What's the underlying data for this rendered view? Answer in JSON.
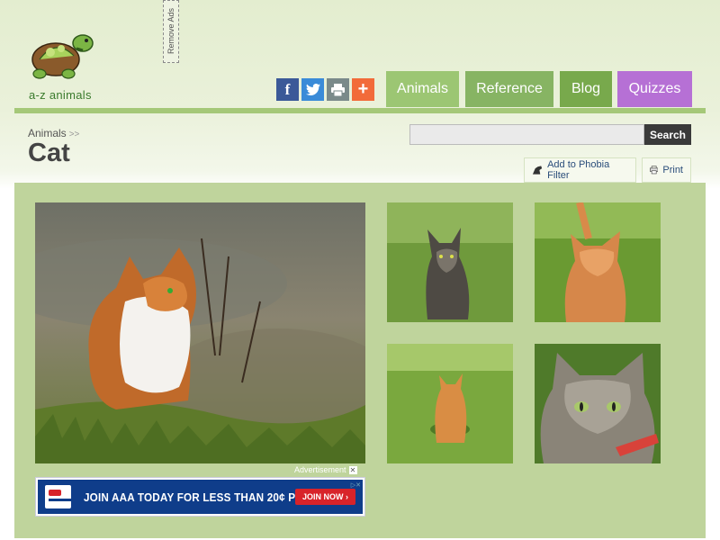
{
  "logo": {
    "text": "a-z animals"
  },
  "remove_ads": "Remove Ads",
  "share": {
    "facebook": "f",
    "twitter": "t",
    "print": "⎙",
    "more": "+"
  },
  "nav": [
    {
      "label": "Animals",
      "color": "#9cc673"
    },
    {
      "label": "Reference",
      "color": "#87b463"
    },
    {
      "label": "Blog",
      "color": "#78a94c"
    },
    {
      "label": "Quizzes",
      "color": "#b670d5"
    }
  ],
  "breadcrumb": {
    "label": "Animals",
    "separator": ">>"
  },
  "page_title": "Cat",
  "search": {
    "placeholder": "",
    "value": "",
    "button": "Search"
  },
  "actions": {
    "phobia": "Add to Phobia Filter",
    "print": "Print"
  },
  "gallery": {
    "main": "cat-photo-main",
    "thumbs": [
      "cat-thumb-1",
      "cat-thumb-2",
      "cat-thumb-3",
      "cat-thumb-4"
    ]
  },
  "ad": {
    "label": "Advertisement",
    "text": "JOIN AAA TODAY FOR LESS THAN 20¢ PER DAY",
    "cta": "JOIN NOW ›"
  },
  "colors": {
    "accent_green": "#a5c878",
    "panel": "#bfd49c"
  }
}
